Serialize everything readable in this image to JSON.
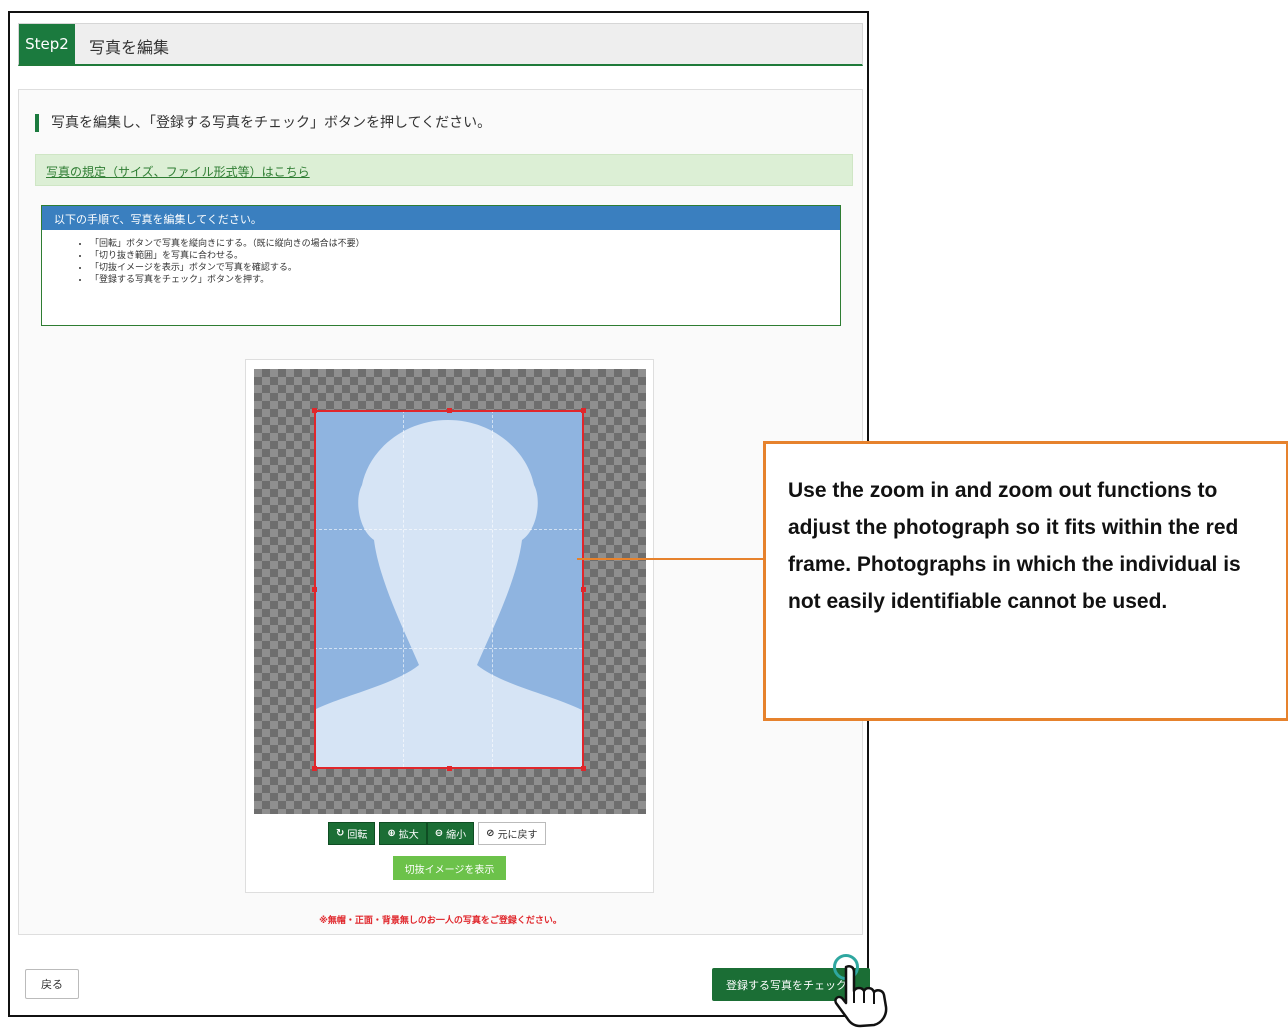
{
  "step": {
    "badge": "Step2",
    "title": "写真を編集"
  },
  "instruction": "写真を編集し、「登録する写真をチェック」ボタンを押してください。",
  "rules_link": "写真の規定（サイズ、ファイル形式等）はこちら",
  "steps_box": {
    "title": "以下の手順で、写真を編集してください。",
    "items": [
      "「回転」ボタンで写真を縦向きにする。（既に縦向きの場合は不要）",
      "「切り抜き範囲」を写真に合わせる。",
      "「切抜イメージを表示」ボタンで写真を確認する。",
      "「登録する写真をチェック」ボタンを押す。"
    ]
  },
  "toolbar": {
    "rotate": {
      "icon": "rotate-icon",
      "label": "回転"
    },
    "zoom_in": {
      "icon": "zoom-in-icon",
      "label": "拡大"
    },
    "zoom_out": {
      "icon": "zoom-out-icon",
      "label": "縮小"
    },
    "reset": {
      "icon": "reset-icon",
      "label": "元に戻す"
    }
  },
  "preview_button": "切抜イメージを表示",
  "warning": "※無帽・正面・背景無しのお一人の写真をご登録ください。",
  "back_button": "戻る",
  "submit_button": "登録する写真をチェック",
  "callout": "Use the zoom in and zoom out functions to adjust the photograph so it fits within the red frame. Photographs in which the individual is not easily identifiable cannot be used.",
  "colors": {
    "brand_green": "#1b7a3e",
    "steps_header_blue": "#3a7fbf",
    "crop_frame_red": "#e0262b",
    "callout_orange": "#e6822d",
    "preview_green": "#6cc24a"
  }
}
